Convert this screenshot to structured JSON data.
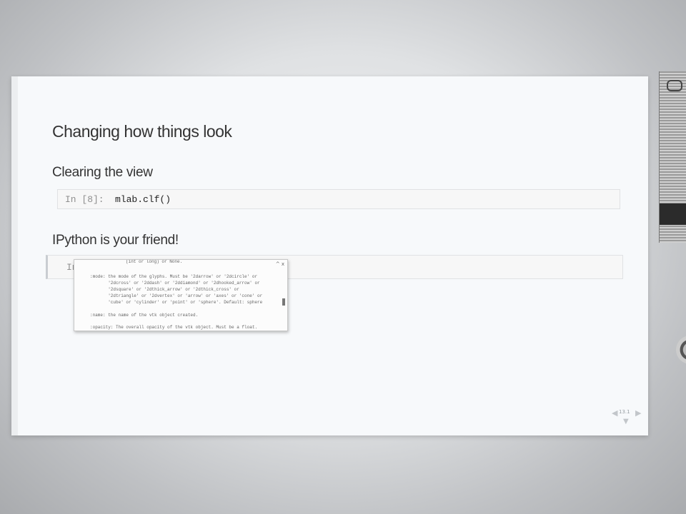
{
  "slide": {
    "title": "Changing how things look",
    "section1": "Clearing the view",
    "cell1": {
      "prompt": "In [8]:",
      "code": "mlab.clf()"
    },
    "section2": "IPython is your friend!",
    "cell2": {
      "prompt": "In"
    }
  },
  "tooltip": {
    "controls": "^ x",
    "lines": [
      "(int or long) or None.",
      ":mode: the mode of the glyphs. Must be '2darrow' or '2dcircle' or",
      "       '2dcross' or '2ddash' or '2ddiamond' or '2dhooked_arrow' or",
      "       '2dsquare' or '2dthick_arrow' or '2dthick_cross' or",
      "       '2dtriangle' or '2dvertex' or 'arrow' or 'axes' or 'cone' or",
      "       'cube' or 'cylinder' or 'point' or 'sphere'. Default: sphere",
      "",
      ":name: the name of the vtk object created.",
      "",
      ":opacity: The overall opacity of the vtk object. Must be a float."
    ]
  },
  "nav": {
    "slide_number": "13.1"
  },
  "colors": {
    "slide_bg": "#f7f9fb",
    "heading": "#333333",
    "prompt": "#8f8f8f"
  }
}
